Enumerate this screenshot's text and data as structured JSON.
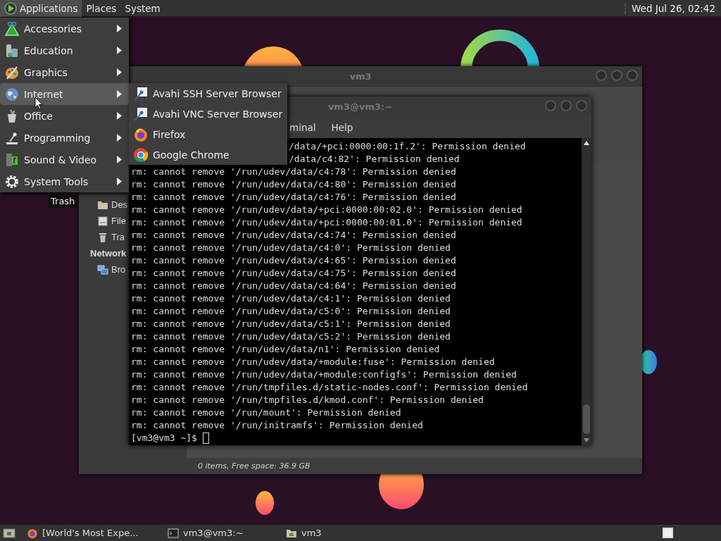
{
  "top_panel": {
    "menus": [
      {
        "label": "Applications",
        "selected": true
      },
      {
        "label": "Places",
        "selected": false
      },
      {
        "label": "System",
        "selected": false
      }
    ],
    "clock": "Wed Jul 26, 02:42"
  },
  "desktop_icons": [
    {
      "label": "Trash"
    }
  ],
  "file_manager": {
    "title": "vm3",
    "sidebar": [
      {
        "label": "Des",
        "kind": "item"
      },
      {
        "label": "File",
        "kind": "item"
      },
      {
        "label": "Tra",
        "kind": "item"
      },
      {
        "label": "Network",
        "kind": "heading"
      },
      {
        "label": "Bro",
        "kind": "item"
      }
    ],
    "status_bar": "0 items, Free space: 36.9 GB"
  },
  "terminal": {
    "title": "vm3@vm3:~",
    "menus": [
      "minal",
      "Help"
    ],
    "lines": [
      {
        "text": "/data/+pci:0000:00:1f.2': Permission denied",
        "kind": "cut"
      },
      {
        "text": "/data/c4:82': Permission denied",
        "kind": "cut"
      },
      {
        "text": "rm: cannot remove '/run/udev/data/c4:78': Permission denied",
        "kind": "full"
      },
      {
        "text": "rm: cannot remove '/run/udev/data/c4:80': Permission denied",
        "kind": "full"
      },
      {
        "text": "rm: cannot remove '/run/udev/data/c4:76': Permission denied",
        "kind": "full"
      },
      {
        "text": "rm: cannot remove '/run/udev/data/+pci:0000:00:02.0': Permission denied",
        "kind": "full"
      },
      {
        "text": "rm: cannot remove '/run/udev/data/+pci:0000:00:01.0': Permission denied",
        "kind": "full"
      },
      {
        "text": "rm: cannot remove '/run/udev/data/c4:74': Permission denied",
        "kind": "full"
      },
      {
        "text": "rm: cannot remove '/run/udev/data/c4:0': Permission denied",
        "kind": "full"
      },
      {
        "text": "rm: cannot remove '/run/udev/data/c4:65': Permission denied",
        "kind": "full"
      },
      {
        "text": "rm: cannot remove '/run/udev/data/c4:75': Permission denied",
        "kind": "full"
      },
      {
        "text": "rm: cannot remove '/run/udev/data/c4:64': Permission denied",
        "kind": "full"
      },
      {
        "text": "rm: cannot remove '/run/udev/data/c4:1': Permission denied",
        "kind": "full"
      },
      {
        "text": "rm: cannot remove '/run/udev/data/c5:0': Permission denied",
        "kind": "full"
      },
      {
        "text": "rm: cannot remove '/run/udev/data/c5:1': Permission denied",
        "kind": "full"
      },
      {
        "text": "rm: cannot remove '/run/udev/data/c5:2': Permission denied",
        "kind": "full"
      },
      {
        "text": "rm: cannot remove '/run/udev/data/n1': Permission denied",
        "kind": "full"
      },
      {
        "text": "rm: cannot remove '/run/udev/data/+module:fuse': Permission denied",
        "kind": "full"
      },
      {
        "text": "rm: cannot remove '/run/udev/data/+module:configfs': Permission denied",
        "kind": "full"
      },
      {
        "text": "rm: cannot remove '/run/tmpfiles.d/static-nodes.conf': Permission denied",
        "kind": "full"
      },
      {
        "text": "rm: cannot remove '/run/tmpfiles.d/kmod.conf': Permission denied",
        "kind": "full"
      },
      {
        "text": "rm: cannot remove '/run/mount': Permission denied",
        "kind": "full"
      },
      {
        "text": "rm: cannot remove '/run/initramfs': Permission denied",
        "kind": "full"
      }
    ],
    "prompt": "[vm3@vm3 ~]$"
  },
  "applications_menu": [
    {
      "label": "Accessories",
      "selected": false
    },
    {
      "label": "Education",
      "selected": false
    },
    {
      "label": "Graphics",
      "selected": false
    },
    {
      "label": "Internet",
      "selected": true
    },
    {
      "label": "Office",
      "selected": false
    },
    {
      "label": "Programming",
      "selected": false
    },
    {
      "label": "Sound & Video",
      "selected": false
    },
    {
      "label": "System Tools",
      "selected": false
    }
  ],
  "internet_submenu": [
    {
      "label": "Avahi SSH Server Browser"
    },
    {
      "label": "Avahi VNC Server Browser"
    },
    {
      "label": "Firefox"
    },
    {
      "label": "Google Chrome"
    }
  ],
  "taskbar": [
    {
      "label": "[World's Most Expe..."
    },
    {
      "label": "vm3@vm3:~"
    },
    {
      "label": "vm3"
    }
  ]
}
